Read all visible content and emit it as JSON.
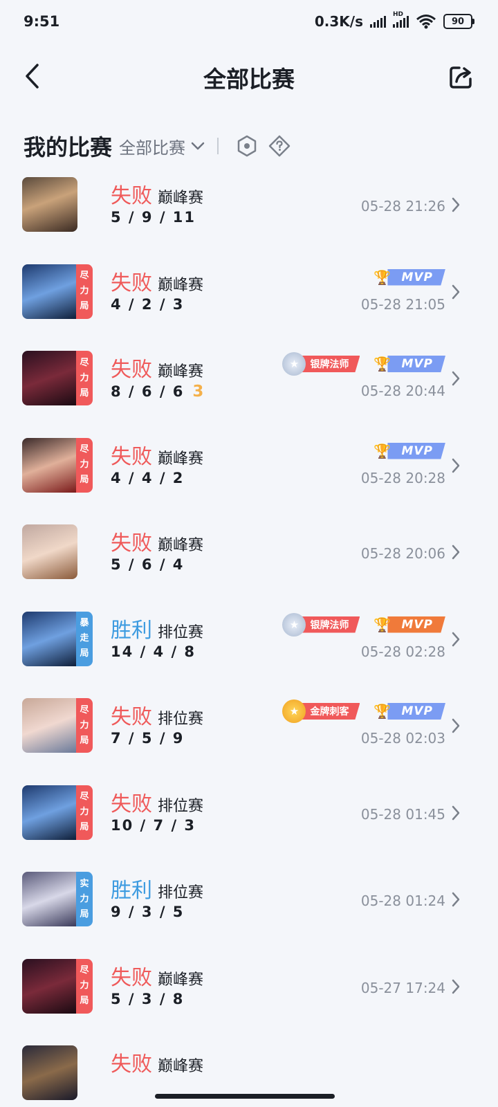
{
  "status_bar": {
    "time": "9:51",
    "speed": "0.3K/s",
    "battery": "90",
    "hd": "HD"
  },
  "header": {
    "title": "全部比赛"
  },
  "filter": {
    "title": "我的比赛",
    "select_label": "全部比赛"
  },
  "colors": {
    "lose": "#ef5a5a",
    "win": "#3d9be0",
    "tag_red": "#f0595a",
    "tag_blue": "#4a9de0",
    "mvp_blue": "#7b9cf3",
    "mvp_gold": "#f07a3a",
    "silver_medal": "#f0595a",
    "gold_medal": "#f0595a"
  },
  "matches": [
    {
      "result": "失败",
      "mode": "巅峰赛",
      "kda": "5 / 9 / 11",
      "time": "05-28 21:26",
      "tag": "",
      "badges": []
    },
    {
      "result": "失败",
      "mode": "巅峰赛",
      "kda": "4 / 2 / 3",
      "time": "05-28 21:05",
      "tag": "尽力局",
      "badges": [
        {
          "type": "mvp",
          "label": "MVP",
          "tone": "blue"
        }
      ]
    },
    {
      "result": "失败",
      "mode": "巅峰赛",
      "kda": "8 / 6 / 6",
      "streak": "3",
      "time": "05-28 20:44",
      "tag": "尽力局",
      "badges": [
        {
          "type": "medal",
          "label": "银牌法师",
          "tone": "silver"
        },
        {
          "type": "mvp",
          "label": "MVP",
          "tone": "blue"
        }
      ]
    },
    {
      "result": "失败",
      "mode": "巅峰赛",
      "kda": "4 / 4 / 2",
      "time": "05-28 20:28",
      "tag": "尽力局",
      "badges": [
        {
          "type": "mvp",
          "label": "MVP",
          "tone": "blue"
        }
      ]
    },
    {
      "result": "失败",
      "mode": "巅峰赛",
      "kda": "5 / 6 / 4",
      "time": "05-28 20:06",
      "tag": "",
      "badges": []
    },
    {
      "result": "胜利",
      "mode": "排位赛",
      "kda": "14 / 4 / 8",
      "time": "05-28 02:28",
      "tag": "暴走局",
      "badges": [
        {
          "type": "medal",
          "label": "银牌法师",
          "tone": "silver"
        },
        {
          "type": "mvp",
          "label": "MVP",
          "tone": "gold"
        }
      ]
    },
    {
      "result": "失败",
      "mode": "排位赛",
      "kda": "7 / 5 / 9",
      "time": "05-28 02:03",
      "tag": "尽力局",
      "badges": [
        {
          "type": "medal",
          "label": "金牌刺客",
          "tone": "gold"
        },
        {
          "type": "mvp",
          "label": "MVP",
          "tone": "blue"
        }
      ]
    },
    {
      "result": "失败",
      "mode": "排位赛",
      "kda": "10 / 7 / 3",
      "time": "05-28 01:45",
      "tag": "尽力局",
      "badges": []
    },
    {
      "result": "胜利",
      "mode": "排位赛",
      "kda": "9 / 3 / 5",
      "time": "05-28 01:24",
      "tag": "实力局",
      "badges": []
    },
    {
      "result": "失败",
      "mode": "巅峰赛",
      "kda": "5 / 3 / 8",
      "time": "05-27 17:24",
      "tag": "尽力局",
      "badges": []
    },
    {
      "result": "失败",
      "mode": "巅峰赛",
      "kda": "",
      "time": "",
      "tag": "",
      "badges": []
    }
  ]
}
